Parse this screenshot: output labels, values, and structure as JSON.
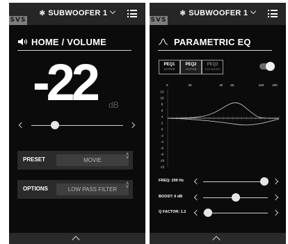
{
  "left_screen": {
    "logo_text": "SVS",
    "device": {
      "bt_icon": "bluetooth-icon",
      "name": "SUBWOOFER 1"
    },
    "menu_icon": "hamburger-menu-icon",
    "heading": "HOME / VOLUME",
    "heading_icon": "speaker-icon",
    "volume": {
      "value": "-22",
      "unit": "dB",
      "slider_fraction": 0.26
    },
    "preset": {
      "label": "PRESET",
      "value": "MOVIE"
    },
    "options": {
      "label": "OPTIONS",
      "value": "LOW PASS FILTER"
    },
    "bottom_icon": "chevron-up-icon"
  },
  "right_screen": {
    "logo_text": "SVS",
    "device": {
      "bt_icon": "bluetooth-icon",
      "name": "SUBWOOFER 1"
    },
    "menu_icon": "hamburger-menu-icon",
    "heading": "PARAMETRIC EQ",
    "heading_icon": "eq-curve-icon",
    "tabs": [
      {
        "label": "PEQ1",
        "state": "ACTIVE"
      },
      {
        "label": "PEQ2",
        "state": "ACTIVE"
      },
      {
        "label": "PEQ3",
        "state": "DISABLED"
      }
    ],
    "toggle_on": true,
    "graph": {
      "x_ticks": [
        "20",
        "40",
        "50",
        "100",
        "200"
      ],
      "y_ticks": [
        "12",
        "8",
        "4",
        "0",
        "-4",
        "-8",
        "-12"
      ],
      "y_ticks_full": [
        "12",
        "10",
        "8",
        "6",
        "4",
        "2",
        "0",
        "-2",
        "-4",
        "-6",
        "-8",
        "-10",
        "-12"
      ]
    },
    "controls": [
      {
        "label": "FREQ: 200 Hz",
        "fraction": 0.95
      },
      {
        "label": "BOOST: 0 dB",
        "fraction": 0.5
      },
      {
        "label": "Q FACTOR: 1.2",
        "fraction": 0.08
      }
    ],
    "bottom_icon": "chevron-up-icon"
  }
}
